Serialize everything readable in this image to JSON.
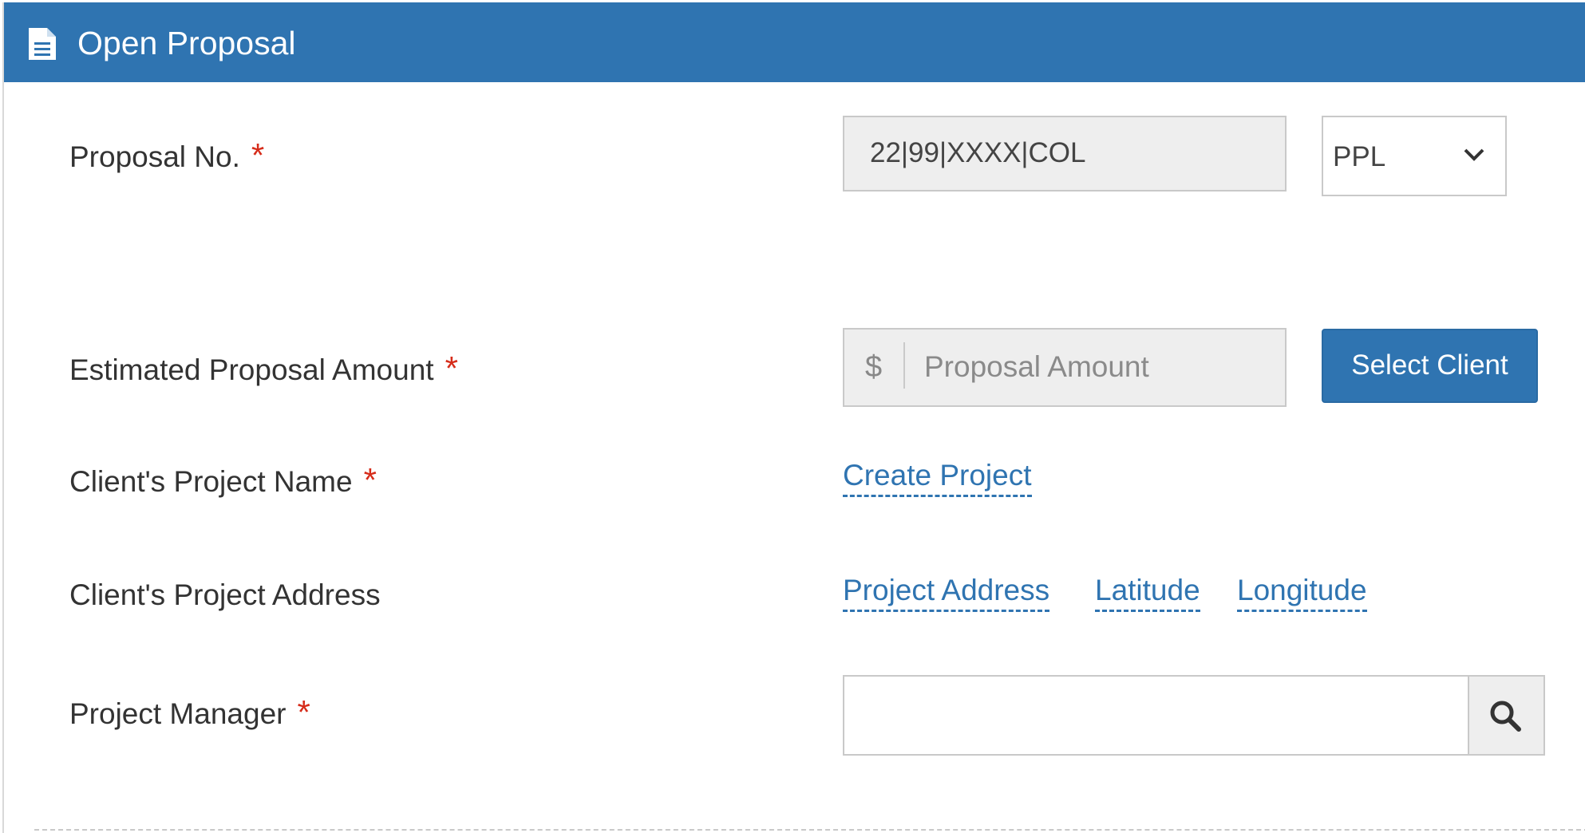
{
  "header": {
    "title": "Open Proposal",
    "icon": "document-icon",
    "background": "#2f74b1"
  },
  "form": {
    "required_marker": "*",
    "proposal_no": {
      "label": "Proposal No.",
      "value": "22|99|XXXX|COL",
      "type_selected": "PPL"
    },
    "estimated_amount": {
      "label": "Estimated Proposal Amount",
      "currency_symbol": "$",
      "placeholder": "Proposal Amount",
      "select_client_label": "Select Client"
    },
    "project_name": {
      "label": "Client's Project Name",
      "link_text": "Create Project"
    },
    "project_address": {
      "label": "Client's Project Address",
      "address_link": "Project Address",
      "latitude_link": "Latitude",
      "longitude_link": "Longitude"
    },
    "project_manager": {
      "label": "Project Manager",
      "value": "",
      "search_icon": "search-icon"
    }
  },
  "colors": {
    "accent": "#2f74b1",
    "required": "#d62c1a",
    "readonly_bg": "#eeeeee"
  }
}
